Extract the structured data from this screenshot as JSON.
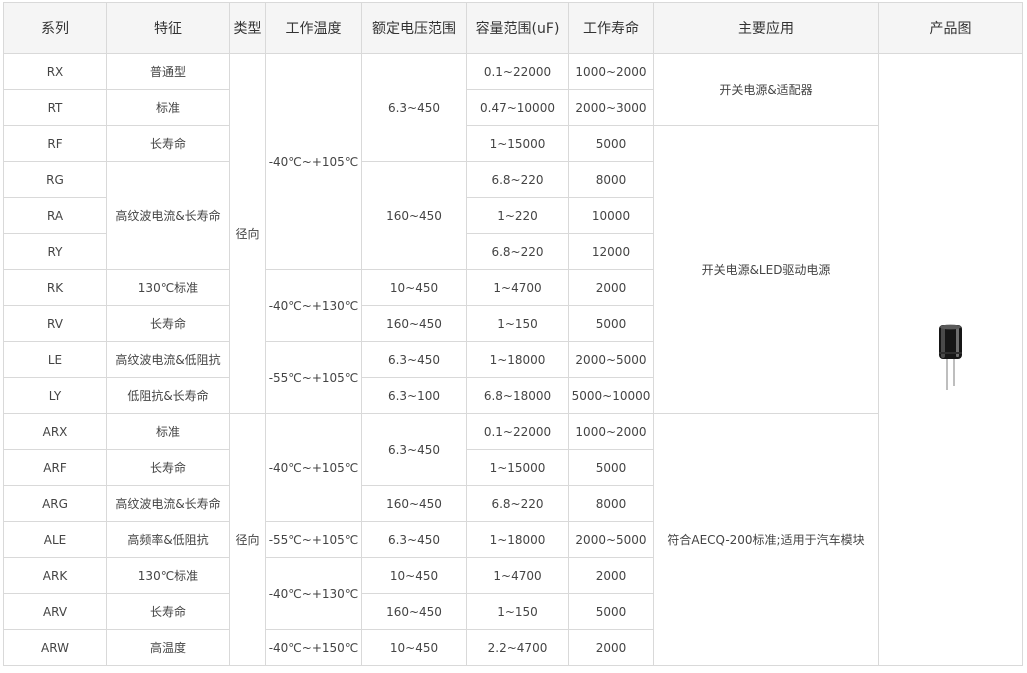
{
  "headers": {
    "series": "系列",
    "feature": "特征",
    "type": "类型",
    "temp": "工作温度",
    "voltage": "额定电压范围",
    "capacitance": "容量范围(uF)",
    "life": "工作寿命",
    "application": "主要应用",
    "image": "产品图"
  },
  "rows": [
    {
      "series": "RX",
      "feature": "普通型",
      "capacitance": "0.1~22000",
      "life": "1000~2000"
    },
    {
      "series": "RT",
      "feature": "标准",
      "capacitance": "0.47~10000",
      "life": "2000~3000"
    },
    {
      "series": "RF",
      "feature": "长寿命",
      "capacitance": "1~15000",
      "life": "5000"
    },
    {
      "series": "RG",
      "capacitance": "6.8~220",
      "life": "8000"
    },
    {
      "series": "RA",
      "capacitance": "1~220",
      "life": "10000"
    },
    {
      "series": "RY",
      "capacitance": "6.8~220",
      "life": "12000"
    },
    {
      "series": "RK",
      "feature": "130℃标准",
      "capacitance": "1~4700",
      "life": "2000"
    },
    {
      "series": "RV",
      "feature": "长寿命",
      "capacitance": "1~150",
      "life": "5000"
    },
    {
      "series": "LE",
      "feature": "高纹波电流&低阻抗",
      "capacitance": "1~18000",
      "life": "2000~5000"
    },
    {
      "series": "LY",
      "feature": "低阻抗&长寿命",
      "capacitance": "6.8~18000",
      "life": "5000~10000"
    },
    {
      "series": "ARX",
      "feature": "标准",
      "capacitance": "0.1~22000",
      "life": "1000~2000"
    },
    {
      "series": "ARF",
      "feature": "长寿命",
      "capacitance": "1~15000",
      "life": "5000"
    },
    {
      "series": "ARG",
      "feature": "高纹波电流&长寿命",
      "capacitance": "6.8~220",
      "life": "8000"
    },
    {
      "series": "ALE",
      "feature": "高频率&低阻抗",
      "capacitance": "1~18000",
      "life": "2000~5000"
    },
    {
      "series": "ARK",
      "feature": "130℃标准",
      "capacitance": "1~4700",
      "life": "2000"
    },
    {
      "series": "ARV",
      "feature": "长寿命",
      "capacitance": "1~150",
      "life": "5000"
    },
    {
      "series": "ARW",
      "feature": "高温度",
      "capacitance": "2.2~4700",
      "life": "2000"
    }
  ],
  "merged": {
    "feature_ripple_long_life": "高纹波电流&长寿命",
    "type_radial_1": "径向",
    "type_radial_2": "径向",
    "temp_105_a": "-40℃~+105℃",
    "temp_130_a": "-40℃~+130℃",
    "temp_55_105_a": "-55℃~+105℃",
    "temp_105_b": "-40℃~+105℃",
    "temp_55_105_b": "-55℃~+105℃",
    "temp_130_b": "-40℃~+130℃",
    "temp_150": "-40℃~+150℃",
    "volt_rx_rf": "6.3~450",
    "volt_rg_ry": "160~450",
    "volt_rk": "10~450",
    "volt_rv": "160~450",
    "volt_le": "6.3~450",
    "volt_ly": "6.3~100",
    "volt_arx_arf": "6.3~450",
    "volt_arg": "160~450",
    "volt_ale": "6.3~450",
    "volt_ark": "10~450",
    "volt_arv": "160~450",
    "volt_arw": "10~450",
    "app_adapter": "开关电源&适配器",
    "app_led": "开关电源&LED驱动电源",
    "app_auto": "符合AECQ-200标准;适用于汽车模块"
  },
  "product_image_icon": "electrolytic-capacitor-icon",
  "colors": {
    "header_bg": "#f5f5f5",
    "border": "#d9d9d9"
  }
}
